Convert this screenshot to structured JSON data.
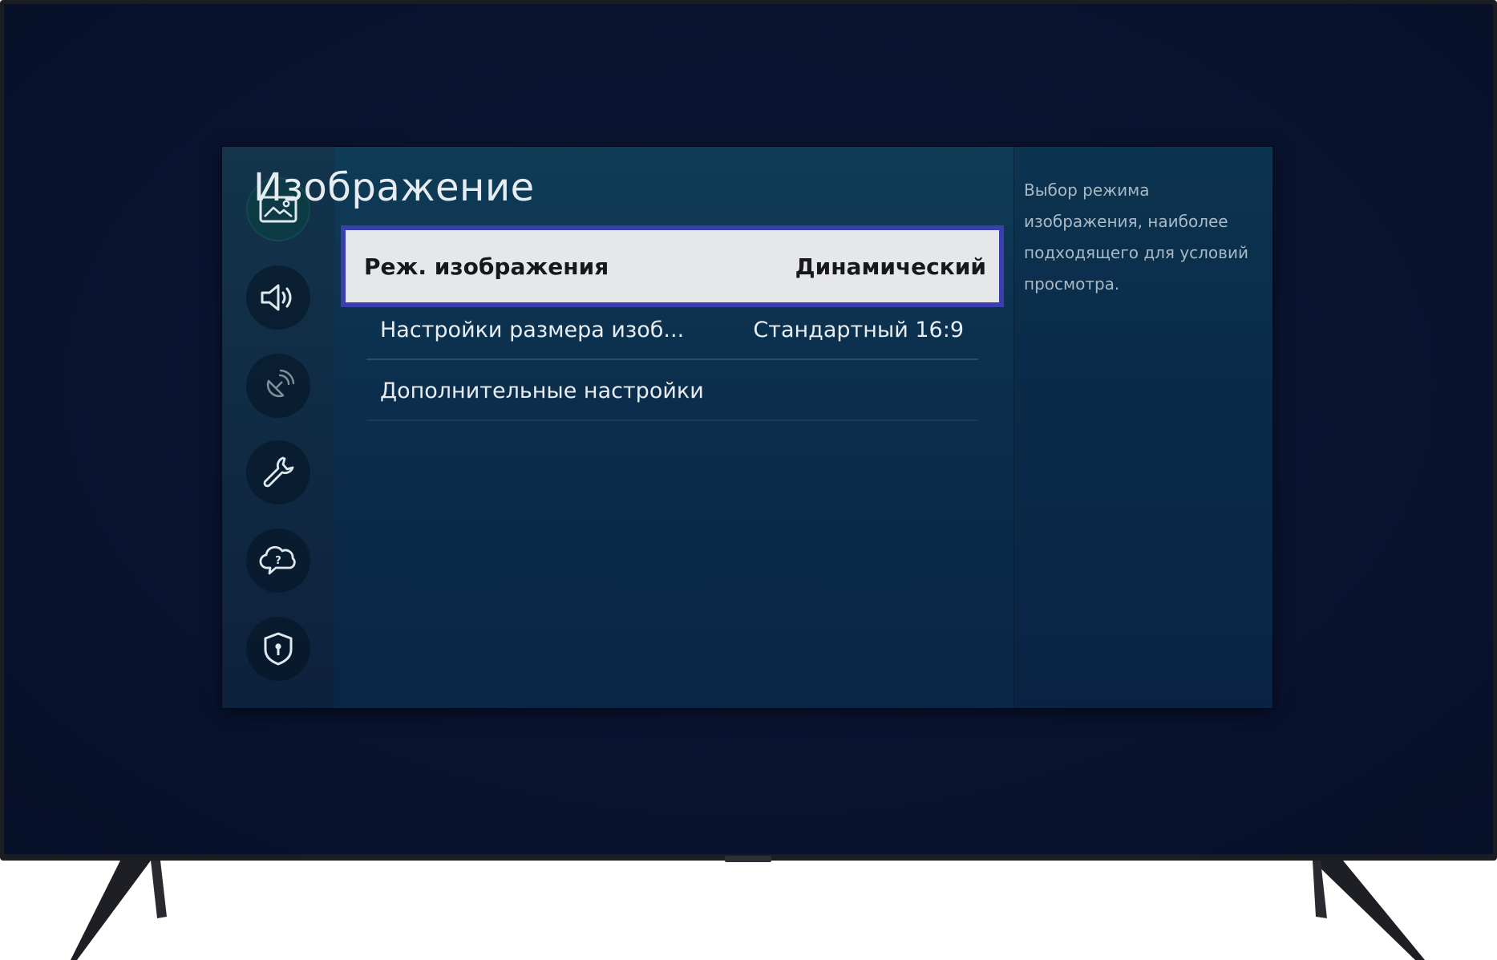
{
  "menu": {
    "title": "Изображение",
    "items": [
      {
        "label": "Реж. изображения",
        "value": "Динамический",
        "selected": true
      },
      {
        "label": "Настройки размера изоб...",
        "value": "Стандартный 16:9",
        "selected": false
      },
      {
        "label": "Дополнительные настройки",
        "value": "",
        "selected": false
      }
    ],
    "description": "Выбор режима изображения, наиболее подходящего для условий просмотра."
  },
  "sidebar": {
    "icons": [
      {
        "name": "picture-icon",
        "active": true
      },
      {
        "name": "sound-icon",
        "active": false
      },
      {
        "name": "broadcasting-icon",
        "active": false
      },
      {
        "name": "general-icon",
        "active": false
      },
      {
        "name": "support-icon",
        "active": false
      },
      {
        "name": "privacy-icon",
        "active": false
      }
    ]
  },
  "colors": {
    "highlight_border": "#3a3fb0",
    "selected_row_bg": "#e6e7e9",
    "screen_bg": "#0a1430",
    "panel_bg": "#0c2f4d"
  }
}
